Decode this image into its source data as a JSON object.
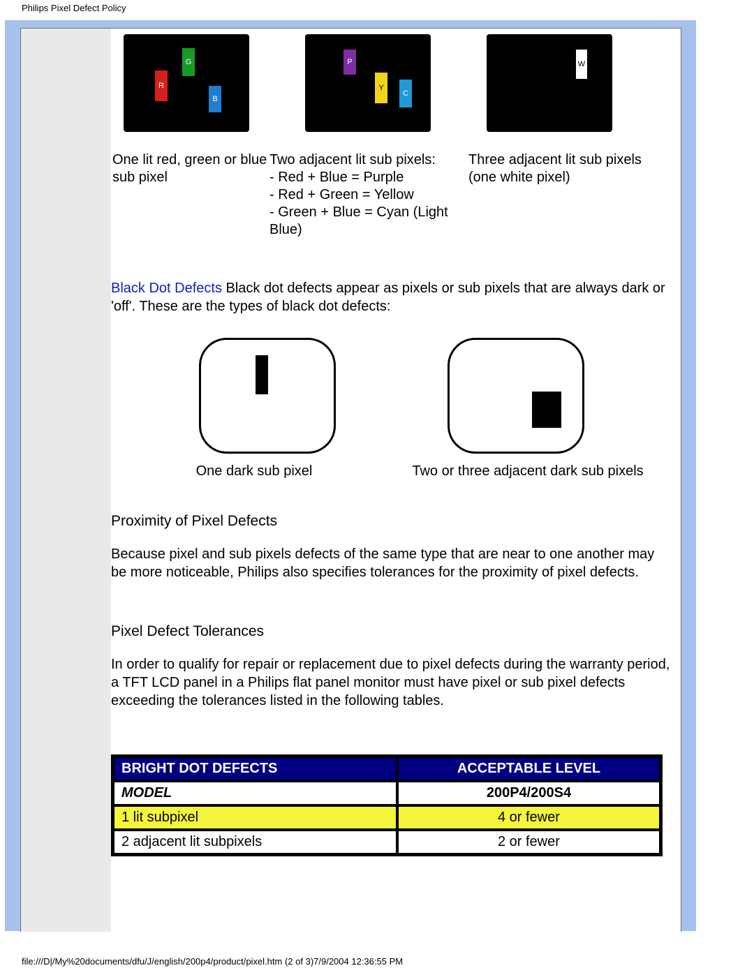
{
  "header": "Philips Pixel Defect Policy",
  "footer": "file:///D|/My%20documents/dfu/J/english/200p4/product/pixel.htm (2 of 3)7/9/2004 12:36:55 PM",
  "top_caps": {
    "c1": "One lit red, green or blue sub pixel",
    "c2_l1": "Two adjacent lit sub pixels:",
    "c2_l2": "- Red + Blue = Purple",
    "c2_l3": "- Red + Green = Yellow",
    "c2_l4": "- Green + Blue = Cyan (Light Blue)",
    "c3": "Three adjacent lit sub pixels (one white pixel)"
  },
  "pix_labels": {
    "R": "R",
    "G": "G",
    "B": "B",
    "P": "P",
    "Y": "Y",
    "C": "C",
    "W": "W"
  },
  "black_dot": {
    "title": "Black Dot Defects",
    "text": " Black dot defects appear as pixels or sub pixels that are always dark or 'off'. These are the types of black dot defects:"
  },
  "mid_caps": {
    "m1": "One dark sub pixel",
    "m2": "Two or three adjacent dark sub pixels"
  },
  "proximity": {
    "h": "Proximity of Pixel Defects",
    "p": "Because pixel and sub pixels defects of the same type that are near to one another may be more noticeable, Philips also specifies tolerances for the proximity of pixel defects."
  },
  "tolerances": {
    "h": "Pixel Defect Tolerances",
    "p": "In order to qualify for repair or replacement due to pixel defects during the warranty period, a TFT LCD panel in a Philips flat panel monitor must have pixel or sub pixel defects exceeding the tolerances listed in the following tables."
  },
  "table": {
    "h1": "BRIGHT DOT DEFECTS",
    "h2": "ACCEPTABLE LEVEL",
    "model_l": "MODEL",
    "model_r": "200P4/200S4",
    "r1_l": "1 lit subpixel",
    "r1_r": "4 or fewer",
    "r2_l": "2 adjacent lit subpixels",
    "r2_r": "2 or fewer"
  }
}
